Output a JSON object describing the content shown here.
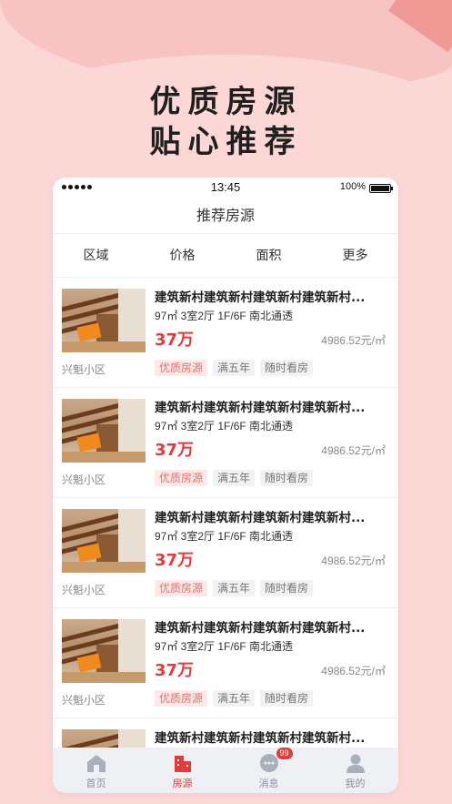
{
  "headline": {
    "line1": "优质房源",
    "line2": "贴心推荐"
  },
  "status_bar": {
    "time": "13:45",
    "battery": "100%"
  },
  "navbar": {
    "title": "推荐房源"
  },
  "filters": [
    "区域",
    "价格",
    "面积",
    "更多"
  ],
  "listings": [
    {
      "title": "建筑新村建筑新村建筑新村建筑新村...",
      "spec": "97㎡  3室2厅  1F/6F  南北通透",
      "price": "37万",
      "unit_price": "4986.52元/㎡",
      "community": "兴魁小区",
      "tags": [
        "优质房源",
        "满五年",
        "随时看房"
      ]
    },
    {
      "title": "建筑新村建筑新村建筑新村建筑新村...",
      "spec": "97㎡  3室2厅  1F/6F  南北通透",
      "price": "37万",
      "unit_price": "4986.52元/㎡",
      "community": "兴魁小区",
      "tags": [
        "优质房源",
        "满五年",
        "随时看房"
      ]
    },
    {
      "title": "建筑新村建筑新村建筑新村建筑新村...",
      "spec": "97㎡  3室2厅  1F/6F  南北通透",
      "price": "37万",
      "unit_price": "4986.52元/㎡",
      "community": "兴魁小区",
      "tags": [
        "优质房源",
        "满五年",
        "随时看房"
      ]
    },
    {
      "title": "建筑新村建筑新村建筑新村建筑新村...",
      "spec": "97㎡  3室2厅  1F/6F  南北通透",
      "price": "37万",
      "unit_price": "4986.52元/㎡",
      "community": "兴魁小区",
      "tags": [
        "优质房源",
        "满五年",
        "随时看房"
      ]
    },
    {
      "title": "建筑新村建筑新村建筑新村建筑新村...",
      "spec": "",
      "price": "",
      "unit_price": "",
      "community": "",
      "tags": []
    }
  ],
  "tabbar": [
    {
      "label": "首页",
      "icon": "home-icon"
    },
    {
      "label": "房源",
      "icon": "building-icon"
    },
    {
      "label": "消息",
      "icon": "message-icon",
      "badge": "99"
    },
    {
      "label": "我的",
      "icon": "user-icon"
    }
  ],
  "colors": {
    "accent": "#e23b3b",
    "background": "#fbd8d6",
    "tag_hot_bg": "#fde9e7"
  }
}
